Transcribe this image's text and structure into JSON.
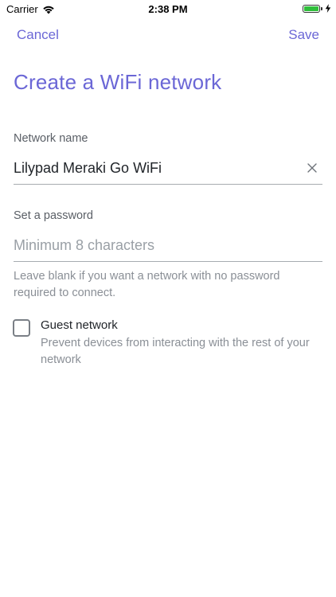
{
  "status_bar": {
    "carrier": "Carrier",
    "time": "2:38 PM"
  },
  "nav": {
    "cancel_label": "Cancel",
    "save_label": "Save"
  },
  "page": {
    "title": "Create a WiFi network"
  },
  "network_name": {
    "label": "Network name",
    "value": "Lilypad Meraki Go WiFi"
  },
  "password": {
    "label": "Set a password",
    "placeholder": "Minimum 8 characters",
    "value": "",
    "helper": "Leave blank if you want a network with no password required to connect."
  },
  "guest": {
    "label": "Guest network",
    "description": "Prevent devices from interacting with the rest of your network",
    "checked": false
  },
  "colors": {
    "accent": "#6b67d6",
    "battery": "#2fbf3b"
  },
  "icons": {
    "wifi": "wifi-icon",
    "battery": "battery-icon",
    "charge": "charging-icon",
    "clear": "close-icon",
    "checkbox": "checkbox-unchecked"
  }
}
